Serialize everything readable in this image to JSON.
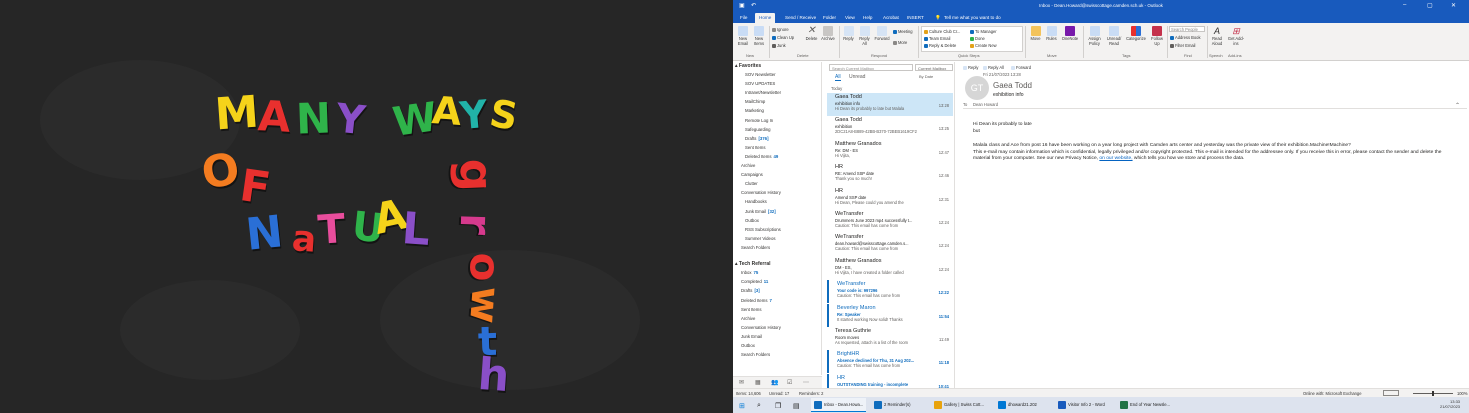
{
  "photo": {
    "word1": [
      "M",
      "A",
      "N",
      "Y"
    ],
    "word2": [
      "W",
      "A",
      "Y",
      "S"
    ],
    "word3": [
      "O",
      "F"
    ],
    "word4": [
      "N",
      "a",
      "T",
      "U",
      "A",
      "L"
    ],
    "word5": [
      "g",
      "r",
      "o",
      "w",
      "t",
      "h"
    ],
    "colors": {
      "red": "#e8302e",
      "orange": "#f47c20",
      "yellow": "#f5d31a",
      "green": "#2fb34a",
      "blue": "#2a6fd6",
      "purple": "#8a4fc8",
      "pink": "#e84d9c",
      "teal": "#21b3a8",
      "magenta": "#d63a8d"
    }
  },
  "outlook": {
    "window_title": "Inbox - Dean.Howard@swisscottage.camden.sch.uk  -  Outlook",
    "tabs": [
      "File",
      "Home",
      "Send / Receive",
      "Folder",
      "View",
      "Help",
      "Acrobat",
      "INSERT"
    ],
    "tell_me": "Tell me what you want to do",
    "ribbon": {
      "new_email": "New Email",
      "new_items": "New Items",
      "ignore": "Ignore",
      "clean_up": "Clean Up",
      "junk": "Junk",
      "delete": "Delete",
      "archive": "Archive",
      "reply": "Reply",
      "reply_all": "Reply All",
      "forward": "Forward",
      "meeting": "Meeting",
      "more": "More",
      "quick_steps": [
        "Culture Club Cr...",
        "Team Email",
        "Reply & Delete",
        "To Manager",
        "Done",
        "Create New"
      ],
      "move": "Move",
      "rules": "Rules",
      "onenote": "OneNote",
      "assign_policy": "Assign Policy",
      "unread_read": "Unread/ Read",
      "categorize": "Categorize",
      "follow_up": "Follow Up",
      "search_people": "Search People",
      "address_book": "Address Book",
      "filter_email": "Filter Email",
      "read_aloud": "Read Aloud",
      "get_addins": "Get Add-ins",
      "groups": [
        "New",
        "Delete",
        "Respond",
        "Quick Steps",
        "Move",
        "Tags",
        "Find",
        "Speech",
        "Add-ins"
      ]
    },
    "folders": [
      {
        "label": "Favorites",
        "type": "header"
      },
      {
        "label": "SOV Newsletter"
      },
      {
        "label": "SOV UPDATES"
      },
      {
        "label": "Intranet/Newsletter"
      },
      {
        "label": "MailChimp"
      },
      {
        "label": "Marketing"
      },
      {
        "label": "Remote Log In"
      },
      {
        "label": "Safeguarding"
      },
      {
        "label": "Drafts",
        "count": "[376]"
      },
      {
        "label": "Sent Items"
      },
      {
        "label": "Deleted Items",
        "count": "49"
      },
      {
        "label": "Archive"
      },
      {
        "label": "Campaigns"
      },
      {
        "label": "Clutter"
      },
      {
        "label": "Conversation History"
      },
      {
        "label": "Handbooks"
      },
      {
        "label": "Junk Email",
        "count": "[32]"
      },
      {
        "label": "Outbox"
      },
      {
        "label": "RSS Subscriptions"
      },
      {
        "label": "Summer Videos"
      },
      {
        "label": "Search Folders"
      },
      {
        "label": "Tech Referral",
        "type": "header"
      },
      {
        "label": "Inbox",
        "count": "75"
      },
      {
        "label": "Completed",
        "count": "11"
      },
      {
        "label": "Drafts",
        "count": "[3]"
      },
      {
        "label": "Deleted Items",
        "count": "7"
      },
      {
        "label": "Sent Items"
      },
      {
        "label": "Archive"
      },
      {
        "label": "Conversation History"
      },
      {
        "label": "Junk Email"
      },
      {
        "label": "Outbox"
      },
      {
        "label": "Search Folders"
      }
    ],
    "search_placeholder": "Search Current Mailbox",
    "scope": "Current Mailbox",
    "filter_all": "All",
    "filter_unread": "Unread",
    "sort": "By Date",
    "today": "Today",
    "messages": [
      {
        "sender": "Gaea Todd",
        "subject": "exhibition info",
        "preview": "Hi Dean its probably to late  but  Malala",
        "time": "13:28",
        "selected": true
      },
      {
        "sender": "Gaea Todd",
        "subject": "exhibition",
        "preview": "2DC21A8-B889-42BB-B370-72BEB1619CF2",
        "time": "13:25"
      },
      {
        "sender": "Matthew Granados",
        "subject": "Re: DM - ES",
        "preview": "Hi Vijita,",
        "time": "12:47"
      },
      {
        "sender": "HR",
        "subject": "RE: Amend SSP date",
        "preview": "Thank you so much!",
        "time": "12:46"
      },
      {
        "sender": "HR",
        "subject": "Amend SSP date",
        "preview": "Hi Dean,  Please could you amend the",
        "time": "12:31"
      },
      {
        "sender": "WeTransfer",
        "subject": "Drummers June 2023 mp4 successfully t...",
        "preview": "Caution: This email has come from",
        "time": "12:24"
      },
      {
        "sender": "WeTransfer",
        "subject": "dean.howard@swisscottage.camden.s...",
        "preview": "Caution: This email has come from",
        "time": "12:24"
      },
      {
        "sender": "Matthew Granados",
        "subject": "DM - ES,",
        "preview": "Hi Vijita,  I have created a folder called",
        "time": "12:24"
      },
      {
        "sender": "WeTransfer",
        "subject": "Your code is: 997296",
        "preview": "Caution: This email has come from",
        "time": "12:22",
        "unread": true
      },
      {
        "sender": "Beverley Maron",
        "subject": "Re: Speaker",
        "preview": "It started working  Now solid!  Thanks",
        "time": "11:54",
        "unread": true
      },
      {
        "sender": "Teresa Guthrie",
        "subject": "Room moves",
        "preview": "As requested, attach is a list of the room",
        "time": "11:49"
      },
      {
        "sender": "BrightHR",
        "subject": "Absence declined for Thu, 31 Aug 202...",
        "preview": "Caution: This email has come from",
        "time": "11:18",
        "unread": true
      },
      {
        "sender": "HR",
        "subject": "OUTSTANDING training - incomplete",
        "preview": "",
        "time": "10:41",
        "unread": true
      }
    ],
    "reading": {
      "reply": "Reply",
      "reply_all": "Reply All",
      "forward": "Forward",
      "date": "Fri 21/07/2023 13:28",
      "initials": "GT",
      "sender": "Gaea Todd",
      "subject": "exhibition info",
      "to_label": "To",
      "to": "Dean Howard",
      "body_line1": "Hi Dean its probably to late",
      "body_line2": "but",
      "body_line3": "Malala class and Ace from post 16 have been working on a year long project with Camden arts center and yesterday was the private view of their exhibition.Machine!Machine?",
      "disclaimer_a": "This e-mail may contain information which is confidential, legally privileged and/or copyright protected. This e-mail is intended for the addressee only. If you receive this in error, please contact the sender and delete the material from your computer. See our new Privacy Notice,",
      "disclaimer_link": "on our website,",
      "disclaimer_b": "which tells you how we store and process the data."
    },
    "status": {
      "items": "Items: 14,606",
      "unread": "Unread: 17",
      "reminders": "Reminders: 2",
      "online": "Online with: Microsoft Exchange",
      "zoom": "100%"
    },
    "taskbar": {
      "apps": [
        "Inbox - Dean.Howa...",
        "2 Reminder(s)",
        "Gallery | Swiss Cott...",
        "dhoward21.202",
        "Visitor Info 2 - Word",
        "End of Year Newsle..."
      ],
      "time": "13:33",
      "date": "21/07/2023"
    }
  }
}
